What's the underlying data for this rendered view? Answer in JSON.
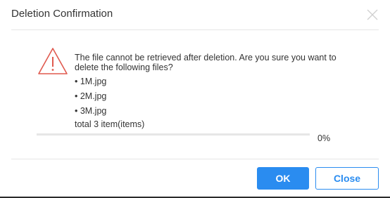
{
  "dialog": {
    "title": "Deletion Confirmation",
    "close_icon": "close-icon",
    "warning_icon": "warning-icon",
    "message": "The file cannot be retrieved after deletion. Are you sure you want to delete the following files?",
    "files": [
      "• 1M.jpg",
      "• 2M.jpg",
      "• 3M.jpg"
    ],
    "total_text": "total 3 item(items)",
    "progress": {
      "percent": 0,
      "label": "0%"
    },
    "buttons": {
      "ok_label": "OK",
      "close_label": "Close"
    },
    "colors": {
      "accent": "#2a8cf0",
      "warning": "#e05a4f"
    }
  }
}
